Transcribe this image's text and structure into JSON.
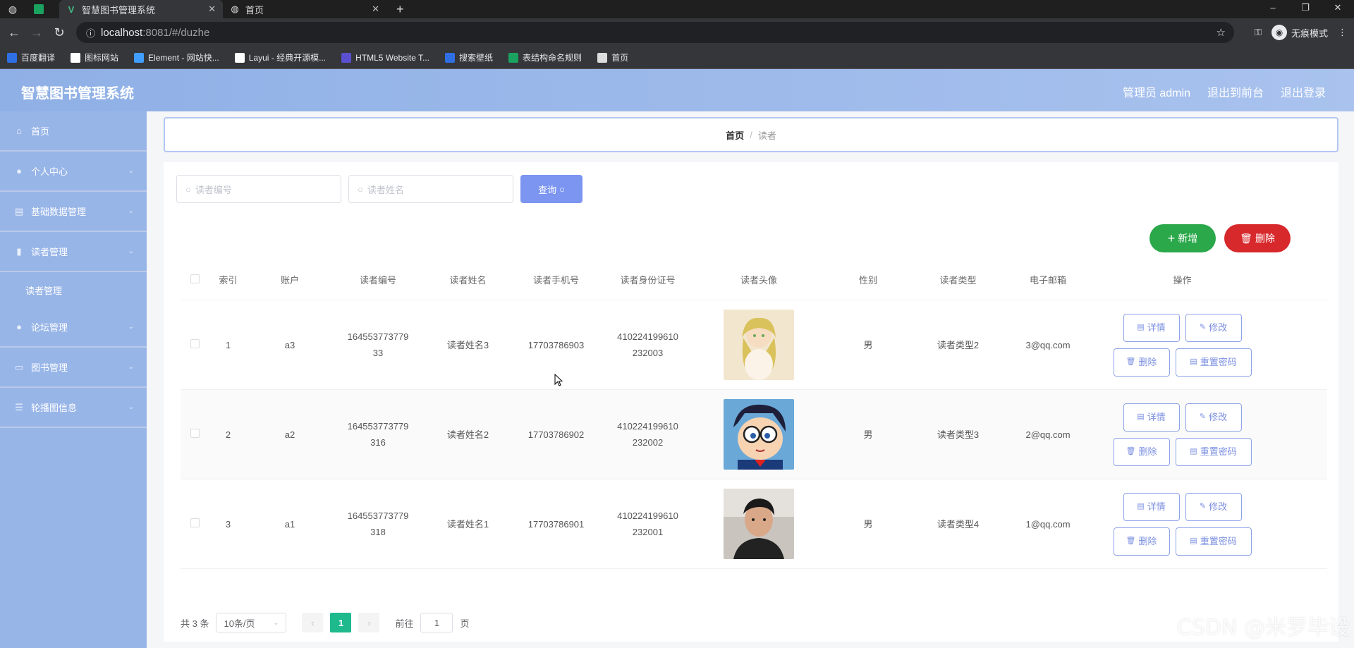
{
  "browser": {
    "tabs": [
      {
        "title": "智慧图书管理系统"
      },
      {
        "title": "首页"
      }
    ],
    "url_host": "localhost",
    "url_rest": ":8081/#/duzhe",
    "incognito_label": "无痕模式",
    "bookmarks": [
      {
        "label": "百度翻译",
        "color": "#2f6fe4"
      },
      {
        "label": "图标网站",
        "color": "#ffffff"
      },
      {
        "label": "Element - 网站快...",
        "color": "#409eff"
      },
      {
        "label": "Layui - 经典开源模...",
        "color": "#ffffff"
      },
      {
        "label": "HTML5 Website T...",
        "color": "#5a4fcf"
      },
      {
        "label": "搜索壁纸",
        "color": "#2f6fe4"
      },
      {
        "label": "表结构命名规则",
        "color": "#1aa260"
      },
      {
        "label": "首页",
        "color": "#dddddd"
      }
    ]
  },
  "app": {
    "title": "智慧图书管理系统",
    "user_label": "管理员 admin",
    "to_front": "退出到前台",
    "logout": "退出登录"
  },
  "sidebar": {
    "items": [
      {
        "label": "首页",
        "icon": "home-icon"
      },
      {
        "label": "个人中心",
        "icon": "user-icon"
      },
      {
        "label": "基础数据管理",
        "icon": "database-icon"
      },
      {
        "label": "读者管理",
        "icon": "reader-icon"
      },
      {
        "label": "论坛管理",
        "icon": "forum-icon"
      },
      {
        "label": "图书管理",
        "icon": "book-icon"
      },
      {
        "label": "轮播图信息",
        "icon": "carousel-icon"
      }
    ],
    "sub_item": "读者管理"
  },
  "breadcrumb": {
    "home": "首页",
    "sep": "/",
    "current": "读者"
  },
  "search": {
    "reader_no_placeholder": "读者编号",
    "reader_name_placeholder": "读者姓名",
    "query_label": "查询"
  },
  "actions": {
    "add_label": "新增",
    "delete_label": "删除"
  },
  "table": {
    "headers": [
      "索引",
      "账户",
      "读者编号",
      "读者姓名",
      "读者手机号",
      "读者身份证号",
      "读者头像",
      "性别",
      "读者类型",
      "电子邮箱",
      "操作"
    ],
    "rows": [
      {
        "index": "1",
        "account": "a3",
        "no_a": "164553773779",
        "no_b": "33",
        "name": "读者姓名3",
        "phone": "17703786903",
        "id_a": "410224199610",
        "id_b": "232003",
        "avatar": "anime-girl",
        "gender": "男",
        "type": "读者类型2",
        "email": "3@qq.com"
      },
      {
        "index": "2",
        "account": "a2",
        "no_a": "164553773779",
        "no_b": "316",
        "name": "读者姓名2",
        "phone": "17703786902",
        "id_a": "410224199610",
        "id_b": "232002",
        "avatar": "detective-boy",
        "gender": "男",
        "type": "读者类型3",
        "email": "2@qq.com"
      },
      {
        "index": "3",
        "account": "a1",
        "no_a": "164553773779",
        "no_b": "318",
        "name": "读者姓名1",
        "phone": "17703786901",
        "id_a": "410224199610",
        "id_b": "232001",
        "avatar": "man-photo",
        "gender": "男",
        "type": "读者类型4",
        "email": "1@qq.com"
      }
    ],
    "op_detail": "详情",
    "op_edit": "修改",
    "op_delete": "删除",
    "op_reset": "重置密码"
  },
  "pager": {
    "total": "共 3 条",
    "page_size": "10条/页",
    "current_page": "1",
    "goto_prefix": "前往",
    "goto_value": "1",
    "goto_suffix": "页"
  },
  "watermark": "CSDN @米罗毕设",
  "colors": {
    "accent": "#7b95f0",
    "add": "#2aa84a",
    "delete": "#d7282c",
    "page_active": "#1fb98e",
    "sidebar": "#98b5e8"
  }
}
